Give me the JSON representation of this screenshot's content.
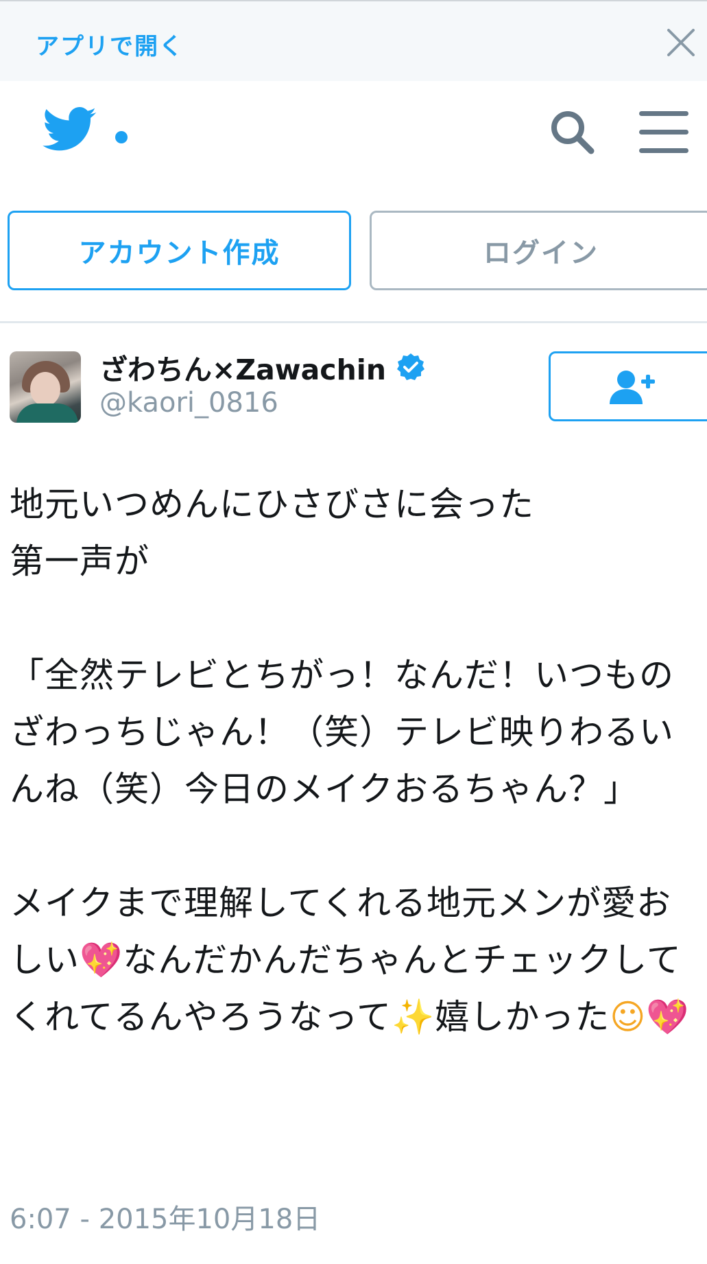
{
  "banner": {
    "open_in_app": "アプリで開く"
  },
  "header": {
    "logo_icon": "twitter-bird-icon",
    "accent": "#1da1f2"
  },
  "auth": {
    "signup_label": "アカウント作成",
    "login_label": "ログイン"
  },
  "tweet": {
    "display_name": "ざわちん×Zawachin",
    "handle": "@kaori_0816",
    "verified": true,
    "text_parts": [
      "地元いつめんにひさびさに会った\n第一声が\n\n「全然テレビとちがっ！なんだ！いつものざわっちじゃん！（笑）テレビ映りわるいんね（笑）今日のメイクおるちゃん？」\n\nメイクまで理解してくれる地元メンが愛おしい",
      "💖",
      "なんだかんだちゃんとチェックしてくれてるんやろうなって",
      "✨",
      "嬉しかった",
      "☺",
      "💖"
    ],
    "timestamp": "6:07 - 2015年10月18日"
  }
}
